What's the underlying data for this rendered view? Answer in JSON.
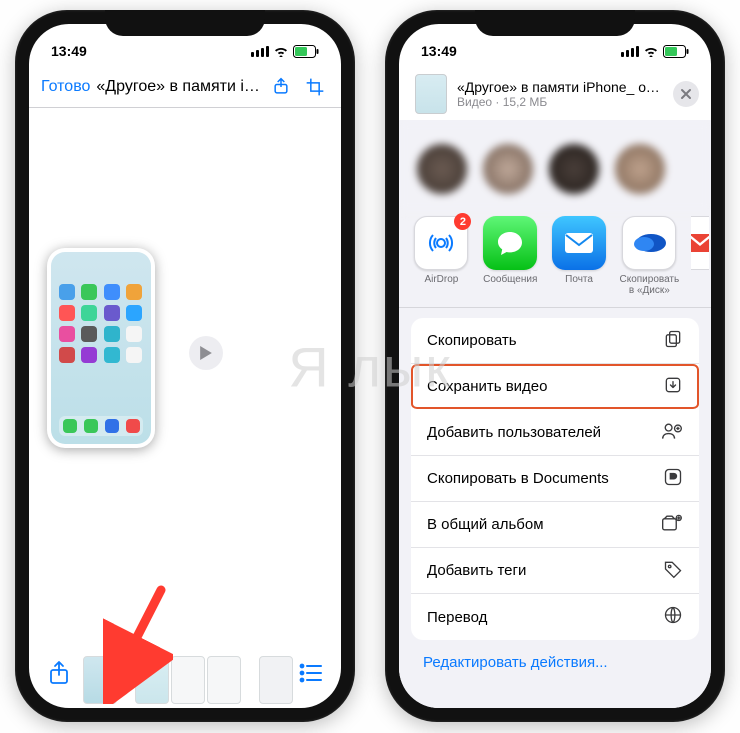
{
  "watermark": "Я   лык",
  "status": {
    "time": "13:49"
  },
  "left": {
    "done": "Готово",
    "title": "«Другое» в памяти iPh..."
  },
  "right": {
    "header": {
      "title": "«Другое» в памяти iPhone_ откуда б...",
      "subtitle": "Видео · 15,2 МБ"
    },
    "apps": {
      "airdrop": "AirDrop",
      "airdrop_badge": "2",
      "messages": "Сообщения",
      "mail": "Почта",
      "ydisk": "Скопировать в «Диск»"
    },
    "actions": {
      "copy": "Скопировать",
      "save_video": "Сохранить видео",
      "add_people": "Добавить пользователей",
      "copy_documents": "Скопировать в Documents",
      "shared_album": "В общий альбом",
      "add_tags": "Добавить теги",
      "translate": "Перевод"
    },
    "edit_actions": "Редактировать действия..."
  }
}
